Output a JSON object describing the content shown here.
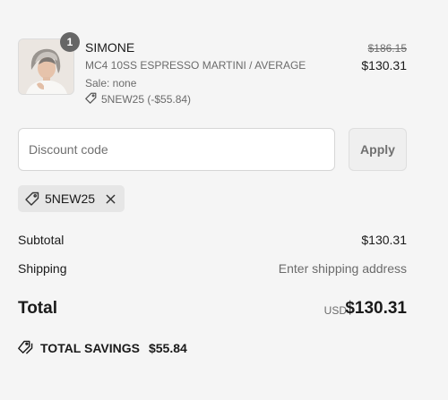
{
  "product": {
    "quantity": "1",
    "name": "SIMONE",
    "variant": "MC4 10SS ESPRESSO MARTINI / AVERAGE",
    "sale": "Sale: none",
    "discount": "5NEW25 (-$55.84)",
    "original_price": "$186.15",
    "price": "$130.31"
  },
  "discount_form": {
    "placeholder": "Discount code",
    "apply_label": "Apply"
  },
  "applied_code": {
    "code": "5NEW25"
  },
  "summary": {
    "subtotal_label": "Subtotal",
    "subtotal_value": "$130.31",
    "shipping_label": "Shipping",
    "shipping_value": "Enter shipping address",
    "total_label": "Total",
    "currency": "USD",
    "total_value": "$130.31",
    "savings_label": "TOTAL SAVINGS",
    "savings_value": "$55.84"
  },
  "icons": [
    "product-thumbnail",
    "tag-icon",
    "close-icon",
    "tags-icon"
  ]
}
